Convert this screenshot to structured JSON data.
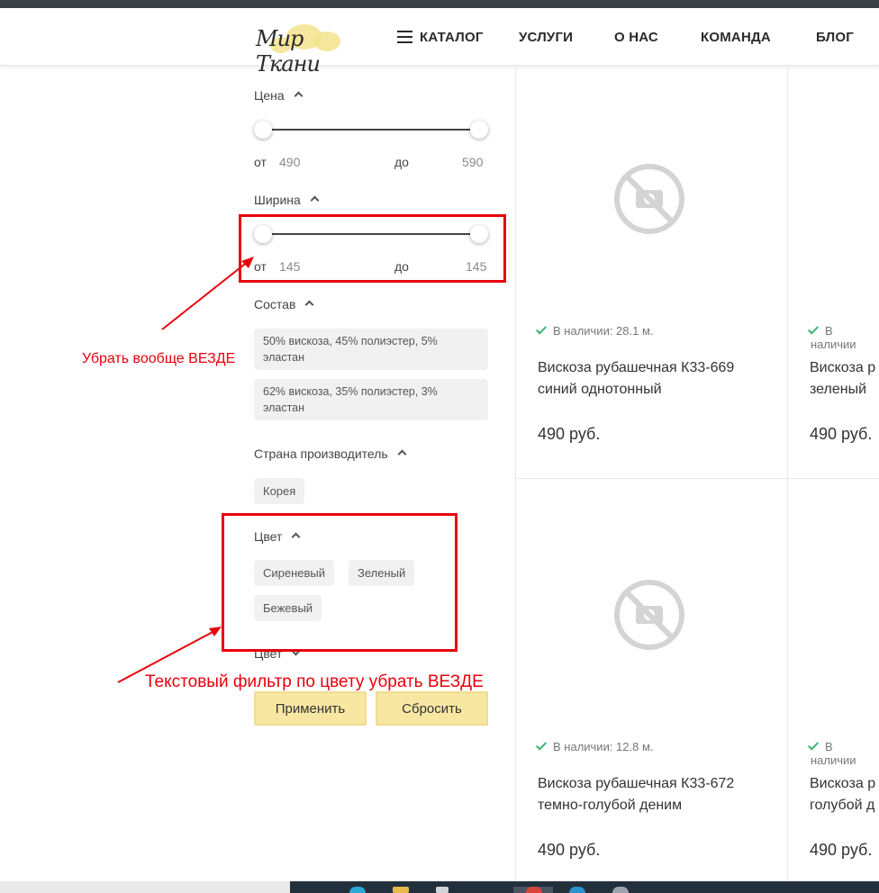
{
  "header": {
    "logo_text": "Мир Ткани",
    "nav": [
      {
        "label": "КАТАЛОГ"
      },
      {
        "label": "УСЛУГИ"
      },
      {
        "label": "О НАС"
      },
      {
        "label": "КОМАНДА"
      },
      {
        "label": "БЛОГ"
      }
    ]
  },
  "filters": {
    "price": {
      "title": "Цена",
      "from_label": "от",
      "from_value": "490",
      "to_label": "до",
      "to_value": "590"
    },
    "width": {
      "title": "Ширина",
      "from_label": "от",
      "from_value": "145",
      "to_label": "до",
      "to_value": "145"
    },
    "composition": {
      "title": "Состав",
      "options": [
        {
          "line1": "50% вискоза, 45% полиэстер, 5%",
          "line2": "эластан"
        },
        {
          "line1": "62% вискоза, 35% полиэстер, 3%",
          "line2": "эластан"
        }
      ]
    },
    "country": {
      "title": "Страна производитель",
      "options": [
        "Корея"
      ]
    },
    "color": {
      "title": "Цвет",
      "options": [
        "Сиреневый",
        "Зеленый",
        "Бежевый"
      ]
    },
    "color_text": {
      "title": "Цвет"
    },
    "apply_label": "Применить",
    "reset_label": "Сбросить"
  },
  "products": [
    {
      "stock": "В наличии: 28.1 м.",
      "name_line1": "Вискоза рубашечная К33-669",
      "name_line2": "синий однотонный",
      "price": "490 руб."
    },
    {
      "stock": "В наличии",
      "name_line1": "Вискоза р",
      "name_line2": "зеленый",
      "price": "490 руб."
    },
    {
      "stock": "В наличии: 12.8 м.",
      "name_line1": "Вискоза рубашечная К33-672",
      "name_line2": "темно-голубой деним",
      "price": "490 руб."
    },
    {
      "stock": "В наличии",
      "name_line1": "Вискоза р",
      "name_line2": "голубой д",
      "price": "490 руб."
    }
  ],
  "annotations": {
    "note1": "Убрать вообще ВЕЗДЕ",
    "note2": "Текстовый фильтр по цвету убрать ВЕЗДЕ",
    "color": "#e8000d"
  },
  "colors": {
    "accent_button": "#f7e7a3",
    "stock_check": "#3bb36b"
  }
}
